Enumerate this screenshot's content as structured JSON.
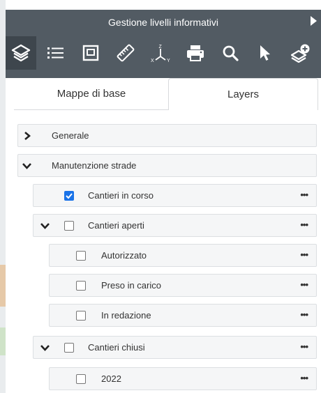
{
  "header": {
    "title": "Gestione livelli informativi",
    "accent": "#525b63",
    "toolbar": [
      {
        "icon": "layers-icon",
        "active": true
      },
      {
        "icon": "list-icon",
        "active": false
      },
      {
        "icon": "extent-icon",
        "active": false
      },
      {
        "icon": "ruler-icon",
        "active": false
      },
      {
        "icon": "xyz-coordinates-icon",
        "active": false
      },
      {
        "icon": "print-icon",
        "active": false
      },
      {
        "icon": "search-icon",
        "active": false
      },
      {
        "icon": "pointer-icon",
        "active": false
      },
      {
        "icon": "add-layer-icon",
        "active": false
      }
    ],
    "xyz": {
      "z": "Z",
      "x": "X",
      "y": "Y"
    }
  },
  "tabs": [
    {
      "label": "Mappe di base",
      "active": false
    },
    {
      "label": "Layers",
      "active": true
    }
  ],
  "tree": {
    "generale": {
      "label": "Generale",
      "expanded": false
    },
    "manutenzione": {
      "label": "Manutenzione strade",
      "expanded": true
    },
    "cantieri_in_corso": {
      "label": "Cantieri in corso",
      "checked": true,
      "menu": "•••"
    },
    "cantieri_aperti": {
      "label": "Cantieri aperti",
      "checked": false,
      "expanded": true,
      "menu": "•••"
    },
    "autorizzato": {
      "label": "Autorizzato",
      "checked": false,
      "menu": "•••"
    },
    "preso_in_carico": {
      "label": "Preso in carico",
      "checked": false,
      "menu": "•••"
    },
    "in_redazione": {
      "label": "In redazione",
      "checked": false,
      "menu": "•••"
    },
    "cantieri_chiusi": {
      "label": "Cantieri chiusi",
      "checked": false,
      "expanded": true,
      "menu": "•••"
    },
    "anno_2022": {
      "label": "2022",
      "checked": false,
      "menu": "•••"
    }
  },
  "colors": {
    "checkbox_checked": "#1a73e8",
    "row_background": "#f5f6f7"
  }
}
